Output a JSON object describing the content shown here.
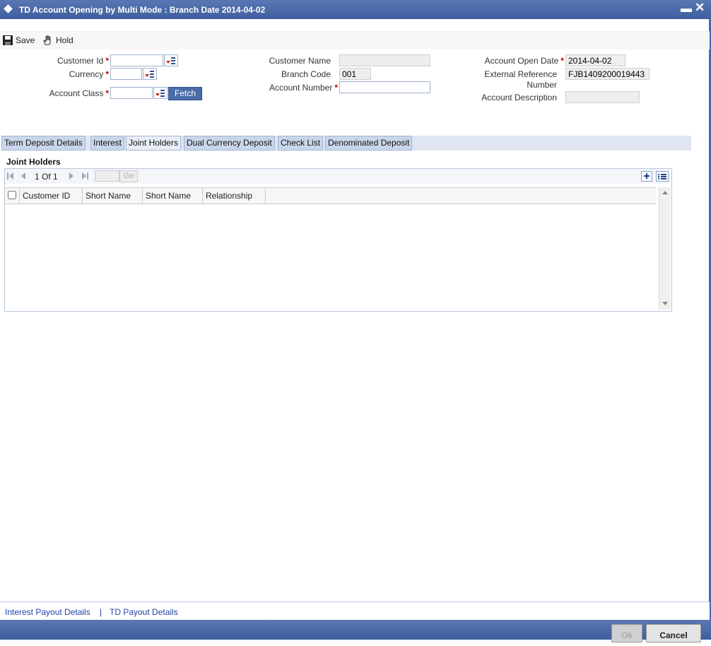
{
  "window": {
    "title": "TD Account Opening by Multi Mode : Branch Date 2014-04-02",
    "minimize_symbol": "▬",
    "close_symbol": "✕"
  },
  "toolbar": {
    "save_label": "Save",
    "hold_label": "Hold"
  },
  "form": {
    "customer_id_label": "Customer Id",
    "currency_label": "Currency",
    "account_class_label": "Account Class",
    "fetch_label": "Fetch",
    "customer_name_label": "Customer Name",
    "customer_name_value": "",
    "branch_code_label": "Branch Code",
    "branch_code_value": "001",
    "account_number_label": "Account Number",
    "account_open_date_label": "Account Open Date",
    "account_open_date_value": "2014-04-02",
    "external_reference_label_1": "External Reference",
    "external_reference_label_2": "Number",
    "external_reference_value": "FJB1409200019443",
    "account_description_label": "Account Description",
    "required_mark": "*"
  },
  "tabs": [
    {
      "label": "Term Deposit Details"
    },
    {
      "label": "Interest"
    },
    {
      "label": "Joint Holders"
    },
    {
      "label": "Dual Currency Deposit"
    },
    {
      "label": "Check List"
    },
    {
      "label": "Denominated Deposit"
    }
  ],
  "active_tab": "Joint Holders",
  "joint_holders": {
    "section_title": "Joint Holders",
    "pager": {
      "page": "1",
      "of_label": "Of",
      "total": "1",
      "go_label": "Go"
    },
    "columns": [
      "Customer ID",
      "Short Name",
      "Short Name",
      "Relationship"
    ],
    "rows": []
  },
  "bottom_links": {
    "interest_payout": "Interest Payout Details",
    "separator": "|",
    "td_payout": "TD Payout Details"
  },
  "footer": {
    "ok_label": "Ok",
    "cancel_label": "Cancel"
  },
  "colors": {
    "titlebar": "#4a68a6",
    "required": "#cc0000",
    "link": "#2244aa"
  }
}
